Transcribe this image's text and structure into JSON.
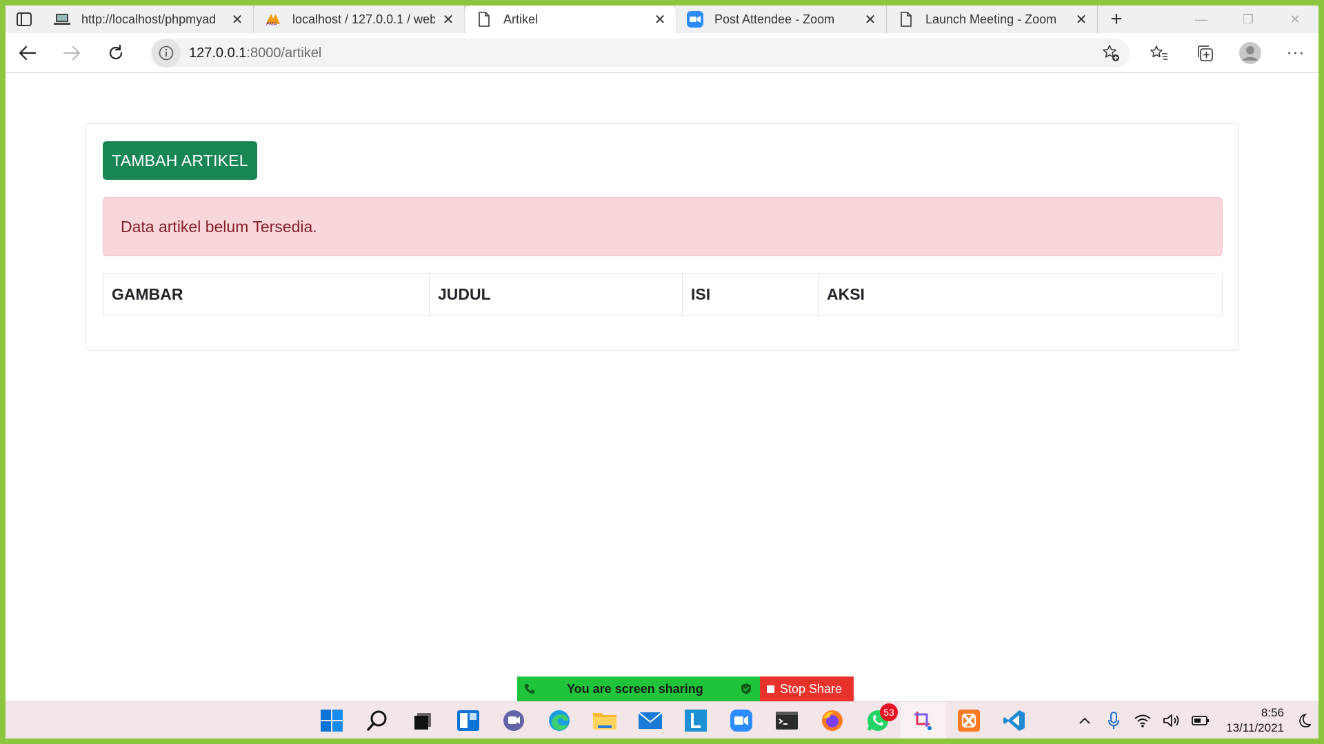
{
  "browser": {
    "tabs": [
      {
        "title": "http://localhost/phpmyad",
        "icon": "laptop-icon",
        "active": false
      },
      {
        "title": "localhost / 127.0.0.1 / web",
        "icon": "phpmyadmin-icon",
        "active": false
      },
      {
        "title": "Artikel",
        "icon": "document-icon",
        "active": true
      },
      {
        "title": "Post Attendee - Zoom",
        "icon": "zoom-icon",
        "active": false
      },
      {
        "title": "Launch Meeting - Zoom",
        "icon": "document-icon",
        "active": false
      }
    ],
    "address": {
      "host": "127.0.0.1",
      "path": ":8000/artikel"
    }
  },
  "page": {
    "add_button": "TAMBAH ARTIKEL",
    "alert": "Data artikel belum Tersedia.",
    "table_headers": [
      "GAMBAR",
      "JUDUL",
      "ISI",
      "AKSI"
    ]
  },
  "screen_share": {
    "status": "You are screen sharing",
    "stop_label": "Stop Share"
  },
  "taskbar": {
    "whatsapp_badge": "53",
    "time": "8:56",
    "date": "13/11/2021"
  },
  "colors": {
    "frame": "#8cc63f",
    "primary_button": "#198754",
    "alert_bg": "#f8d7da",
    "alert_text": "#842029",
    "share_green": "#20c43a",
    "share_red": "#e8322c"
  }
}
